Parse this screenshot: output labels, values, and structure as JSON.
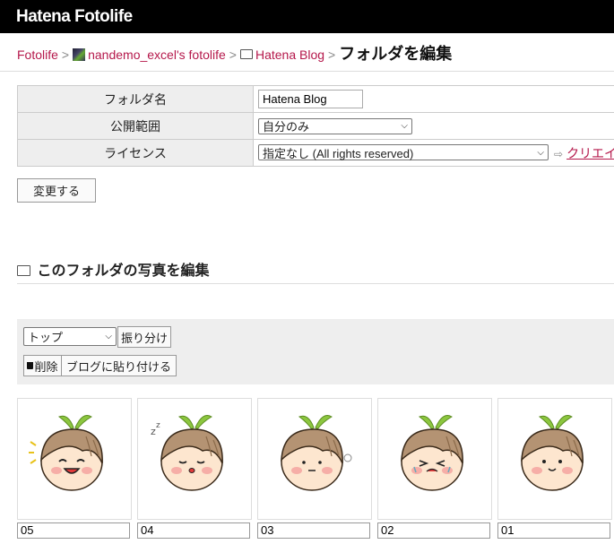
{
  "header": {
    "logo": "Hatena Fotolife"
  },
  "breadcrumb": {
    "root": "Fotolife",
    "sep": ">",
    "user": "nandemo_excel's fotolife",
    "folder": "Hatena Blog",
    "current": "フォルダを編集"
  },
  "settings": {
    "folder_name_label": "フォルダ名",
    "folder_name_value": "Hatena Blog",
    "visibility_label": "公開範囲",
    "visibility_value": "自分のみ",
    "license_label": "ライセンス",
    "license_value": "指定なし (All rights reserved)",
    "cc_link": "クリエイ"
  },
  "buttons": {
    "change": "変更する",
    "sort": "振り分け",
    "delete": "削除",
    "paste_to_blog": "ブログに貼り付ける"
  },
  "section": {
    "title": "このフォルダの写真を編集"
  },
  "toolbar": {
    "move_target": "トップ"
  },
  "photos": [
    {
      "caption": "05",
      "expression": "laugh"
    },
    {
      "caption": "04",
      "expression": "sleep"
    },
    {
      "caption": "03",
      "expression": "surprised"
    },
    {
      "caption": "02",
      "expression": "cry"
    },
    {
      "caption": "01",
      "expression": "smile"
    }
  ]
}
